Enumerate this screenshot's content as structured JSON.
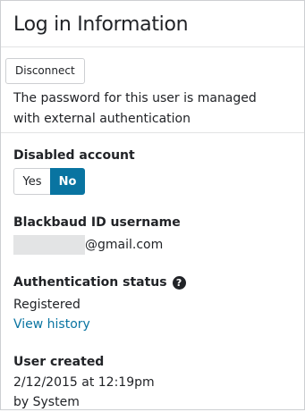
{
  "header": {
    "title": "Log in Information"
  },
  "auth": {
    "disconnect_label": "Disconnect",
    "managed_text": "The password for this user is managed with external authentication"
  },
  "disabled_account": {
    "label": "Disabled account",
    "options": [
      "Yes",
      "No"
    ],
    "selected": "No"
  },
  "username": {
    "label": "Blackbaud ID username",
    "value_suffix": "@gmail.com"
  },
  "auth_status": {
    "label": "Authentication status",
    "help_icon": "question-circle-icon",
    "help_glyph": "?",
    "value": "Registered",
    "history_link": "View history"
  },
  "user_created": {
    "label": "User created",
    "date": "2/12/2015 at 12:19pm",
    "by": "by System"
  },
  "colors": {
    "accent": "#0974a1",
    "border": "#cdcfd2",
    "text": "#212327"
  }
}
